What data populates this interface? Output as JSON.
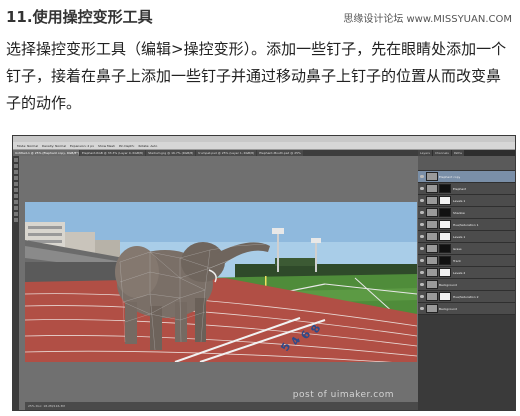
{
  "article": {
    "heading": "11.使用操控变形工具",
    "site_watermark": "思缘设计论坛 www.MISSYUAN.COM",
    "paragraph": "选择操控变形工具（编辑>操控变形）。添加一些钉子，先在眼睛处添加一个钉子，接着在鼻子上添加一些钉子并通过移动鼻子上钉子的位置从而改变鼻子的动作。"
  },
  "photoshop": {
    "options": [
      "Mode: Normal",
      "Density: Normal",
      "Expansion: 2 px",
      "Show Mesh",
      "Pin Depth:",
      "Rotate: Auto"
    ],
    "tabs": [
      {
        "label": "Untitled-1 @ 25% (Elephant copy, RGB/8*)",
        "active": true
      },
      {
        "label": "Elephant-RGB @ 33.3% (Layer 0, RGB/8)",
        "active": false
      },
      {
        "label": "Stadium.jpg @ 16.7% (RGB/8)",
        "active": false
      },
      {
        "label": "trumpet.psd @ 25% (Layer 1, RGB/8)",
        "active": false
      },
      {
        "label": "Elephant-Mouth.psd @ 25%",
        "active": false
      }
    ],
    "status": "25%   Doc: 18.2M/116.3M",
    "panel_tabs": [
      "Layers",
      "Channels",
      "Paths"
    ],
    "layers": [
      {
        "name": "Elephant copy",
        "selected": true,
        "mask": "none"
      },
      {
        "name": "Elephant",
        "selected": false,
        "mask": "black"
      },
      {
        "name": "Levels 1",
        "selected": false,
        "mask": "white"
      },
      {
        "name": "Shadow",
        "selected": false,
        "mask": "black"
      },
      {
        "name": "Hue/Saturation 1",
        "selected": false,
        "mask": "white"
      },
      {
        "name": "Levels 1",
        "selected": false,
        "mask": "white"
      },
      {
        "name": "Grass",
        "selected": false,
        "mask": "black"
      },
      {
        "name": "Track",
        "selected": false,
        "mask": "black"
      },
      {
        "name": "Levels 2",
        "selected": false,
        "mask": "white"
      },
      {
        "name": "Background",
        "selected": false,
        "mask": "none"
      },
      {
        "name": "Hue/Saturation 2",
        "selected": false,
        "mask": "white"
      },
      {
        "name": "Background",
        "selected": false,
        "mask": "none"
      }
    ]
  },
  "bottom_watermark": "post of uimaker.com",
  "colors": {
    "sky": "#9ec6e6",
    "track": "#b5524a",
    "grass": "#4d8b3a",
    "elephant": "#7a6f67",
    "ps_dark": "#3a3a3a"
  }
}
